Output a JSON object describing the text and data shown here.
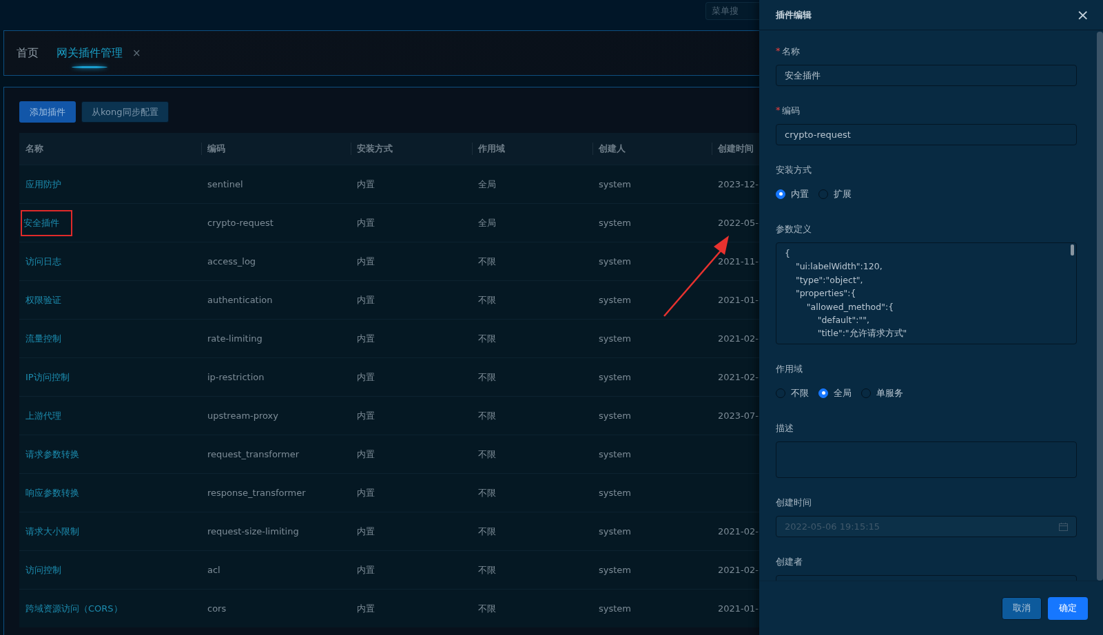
{
  "top_bar": {
    "menu_search": {
      "placeholder": "菜单搜"
    }
  },
  "tabs": [
    {
      "label": "首页",
      "selected": false,
      "closable": false
    },
    {
      "label": "网关插件管理",
      "selected": true,
      "closable": true
    }
  ],
  "close_glyph": "×",
  "toolbar": {
    "buttons": [
      {
        "label": "添加插件",
        "kind": "primary"
      },
      {
        "label": "从kong同步配置",
        "kind": "secondary"
      }
    ]
  },
  "table": {
    "columns": [
      "名称",
      "编码",
      "安装方式",
      "作用域",
      "创建人",
      "创建时间"
    ],
    "rows": [
      {
        "name": "应用防护",
        "code": "sentinel",
        "install": "内置",
        "scope": "全局",
        "creator": "system",
        "created": "2023-12-",
        "highlighted": false
      },
      {
        "name": "安全插件",
        "code": "crypto-request",
        "install": "内置",
        "scope": "全局",
        "creator": "system",
        "created": "2022-05-",
        "highlighted": true
      },
      {
        "name": "访问日志",
        "code": "access_log",
        "install": "内置",
        "scope": "不限",
        "creator": "system",
        "created": "2021-11-",
        "highlighted": false
      },
      {
        "name": "权限验证",
        "code": "authentication",
        "install": "内置",
        "scope": "不限",
        "creator": "system",
        "created": "2021-01-",
        "highlighted": false
      },
      {
        "name": "流量控制",
        "code": "rate-limiting",
        "install": "内置",
        "scope": "不限",
        "creator": "system",
        "created": "2021-02-",
        "highlighted": false
      },
      {
        "name": "IP访问控制",
        "code": "ip-restriction",
        "install": "内置",
        "scope": "不限",
        "creator": "system",
        "created": "2021-02-",
        "highlighted": false
      },
      {
        "name": "上游代理",
        "code": "upstream-proxy",
        "install": "内置",
        "scope": "不限",
        "creator": "system",
        "created": "2023-07-",
        "highlighted": false
      },
      {
        "name": "请求参数转换",
        "code": "request_transformer",
        "install": "内置",
        "scope": "不限",
        "creator": "system",
        "highlighted": false
      },
      {
        "name": "响应参数转换",
        "code": "response_transformer",
        "install": "内置",
        "scope": "不限",
        "creator": "system",
        "highlighted": false
      },
      {
        "name": "请求大小限制",
        "code": "request-size-limiting",
        "install": "内置",
        "scope": "不限",
        "creator": "system",
        "created": "2021-02-",
        "highlighted": false
      },
      {
        "name": "访问控制",
        "code": "acl",
        "install": "内置",
        "scope": "不限",
        "creator": "system",
        "created": "2021-02-",
        "highlighted": false
      },
      {
        "name": "跨域资源访问（CORS）",
        "code": "cors",
        "install": "内置",
        "scope": "不限",
        "creator": "system",
        "created": "2021-01-",
        "highlighted": false
      }
    ]
  },
  "drawer": {
    "title": "插件编辑",
    "close": "×",
    "fields": [
      {
        "kind": "text",
        "label": "名称",
        "required_mark": "*",
        "value": "安全插件"
      },
      {
        "kind": "text",
        "label": "编码",
        "required_mark": "*",
        "value": "crypto-request"
      },
      {
        "kind": "radio",
        "label": "安装方式",
        "options": [
          {
            "label": "内置",
            "selected": true
          },
          {
            "label": "扩展",
            "selected": false
          }
        ]
      },
      {
        "kind": "code",
        "label": "参数定义",
        "lines": [
          "{",
          "\t\"ui:labelWidth\":120,",
          "\t\"type\":\"object\",",
          "\t\"properties\":{",
          "\t\t\"allowed_method\":{",
          "\t\t\t\"default\":\"\",",
          "\t\t\t\"title\":\"允许请求方式\""
        ]
      },
      {
        "kind": "radio",
        "label": "作用域",
        "options": [
          {
            "label": "不限",
            "selected": false
          },
          {
            "label": "全局",
            "selected": true
          },
          {
            "label": "单服务",
            "selected": false
          }
        ]
      },
      {
        "kind": "textarea",
        "label": "描述"
      },
      {
        "kind": "date",
        "label": "创建时间",
        "value": "2022-05-06 19:15:15",
        "disabled": true
      },
      {
        "kind": "text",
        "label": "创建者"
      }
    ],
    "buttons": [
      {
        "label": "取消",
        "kind": "secondary"
      },
      {
        "label": "确定",
        "kind": "primary"
      }
    ]
  }
}
